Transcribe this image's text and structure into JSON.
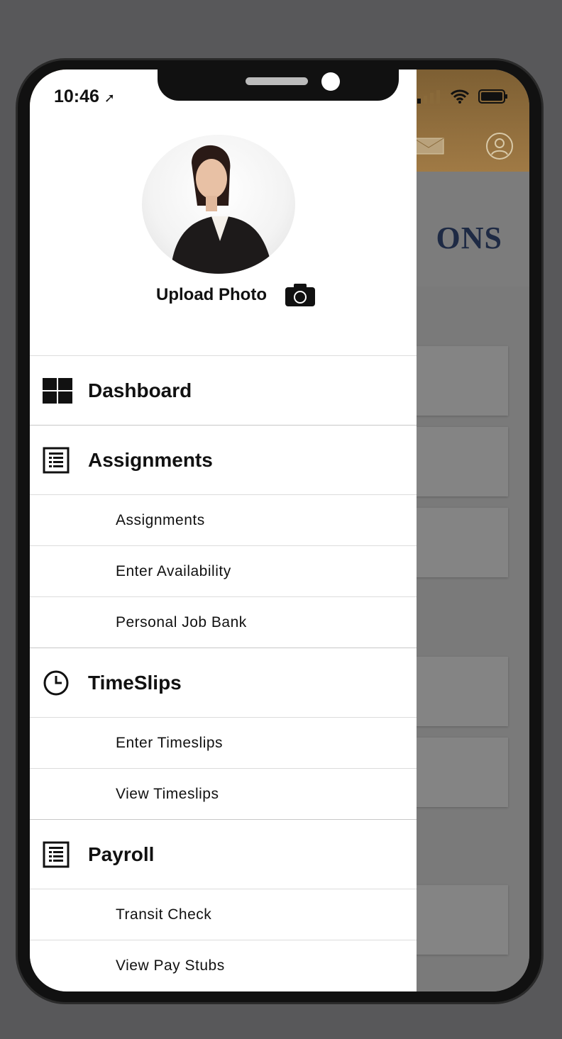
{
  "status_bar": {
    "time": "10:46"
  },
  "background_app": {
    "title_fragment": "ONS",
    "header_color": "#a07a45",
    "icons": [
      "mail-icon",
      "profile-icon"
    ]
  },
  "drawer": {
    "upload_photo_label": "Upload Photo",
    "sections": [
      {
        "label": "Dashboard",
        "icon": "dashboard-grid-icon",
        "items": []
      },
      {
        "label": "Assignments",
        "icon": "list-document-icon",
        "items": [
          "Assignments",
          "Enter Availability",
          "Personal Job Bank"
        ]
      },
      {
        "label": "TimeSlips",
        "icon": "clock-icon",
        "items": [
          "Enter Timeslips",
          "View Timeslips"
        ]
      },
      {
        "label": "Payroll",
        "icon": "list-document-icon",
        "items": [
          "Transit Check",
          "View Pay Stubs"
        ]
      }
    ]
  }
}
